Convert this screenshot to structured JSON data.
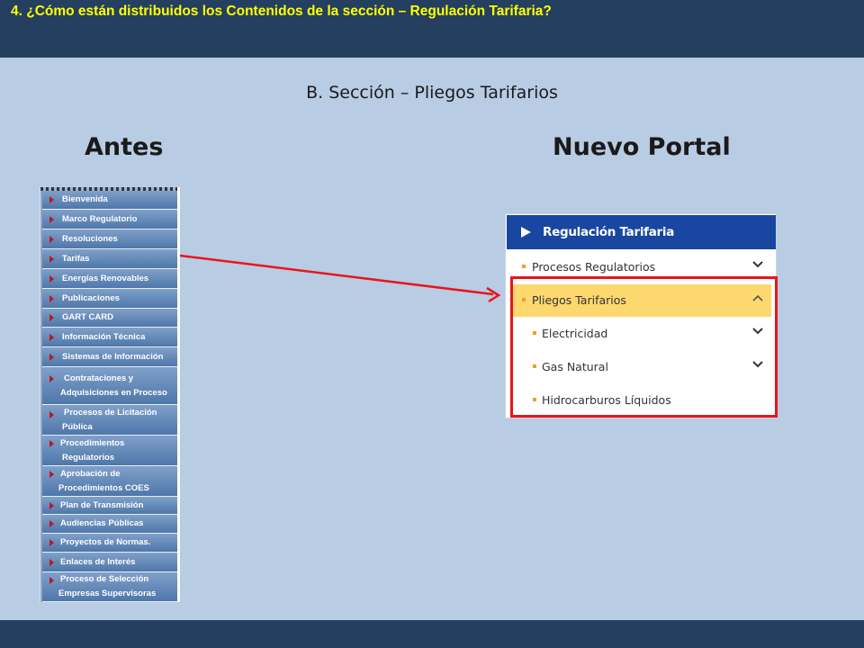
{
  "header": {
    "title": "4. ¿Cómo están distribuidos los Contenidos de la sección –  Regulación Tarifaria?"
  },
  "subtitle": "B. Sección – Pliegos Tarifarios",
  "columns": {
    "before": "Antes",
    "after": "Nuevo Portal"
  },
  "old_menu": {
    "items": [
      {
        "l1": "Bienvenida",
        "l2": ""
      },
      {
        "l1": "Marco Regulatorio",
        "l2": ""
      },
      {
        "l1": "Resoluciones",
        "l2": ""
      },
      {
        "l1": "Tarifas",
        "l2": ""
      },
      {
        "l1": "Energías Renovables",
        "l2": ""
      },
      {
        "l1": "Publicaciones",
        "l2": ""
      },
      {
        "l1": "GART CARD",
        "l2": ""
      },
      {
        "l1": "Información Técnica",
        "l2": ""
      },
      {
        "l1": "Sistemas de Información",
        "l2": ""
      },
      {
        "l1": "Contrataciones y",
        "l2": "Adquisiciones en Proceso"
      },
      {
        "l1": "Procesos de Licitación",
        "l2": "Pública"
      },
      {
        "l1": "Procedimientos",
        "l2": "Regulatorios"
      },
      {
        "l1": "Aprobación de",
        "l2": "Procedimientos COES"
      },
      {
        "l1": "Plan de Transmisión",
        "l2": ""
      },
      {
        "l1": "Audiencias Públicas",
        "l2": ""
      },
      {
        "l1": "Proyectos de Normas.",
        "l2": ""
      },
      {
        "l1": "Enlaces de Interés",
        "l2": ""
      },
      {
        "l1": "Proceso de Selección",
        "l2": "Empresas Supervisoras"
      }
    ]
  },
  "new_menu": {
    "title": "Regulación Tarifaria",
    "items": [
      {
        "label": "Procesos Regulatorios",
        "chevron": "chevron-down-icon"
      },
      {
        "label": "Pliegos Tarifarios",
        "chevron": "chevron-up-icon"
      },
      {
        "label": "Electricidad",
        "chevron": "chevron-down-icon"
      },
      {
        "label": "Gas Natural",
        "chevron": "chevron-down-icon"
      },
      {
        "label": "Hidrocarburos Líquidos",
        "chevron": ""
      }
    ]
  },
  "colors": {
    "highlight": "#e8151b",
    "active_row": "#fdd86f",
    "header_blue": "#1846a0",
    "bar": "#243f60"
  }
}
